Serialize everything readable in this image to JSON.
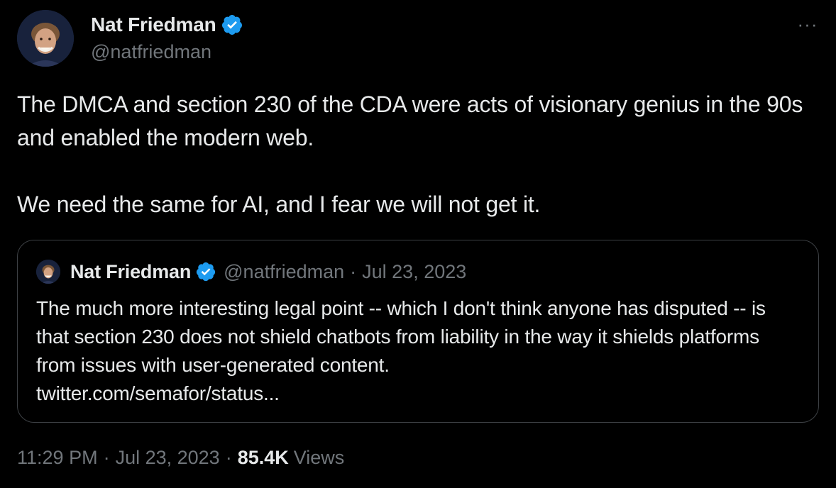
{
  "tweet": {
    "author": {
      "name": "Nat Friedman",
      "handle": "@natfriedman",
      "avatar_icon": "profile-photo"
    },
    "verified_icon": "verified-badge-icon",
    "more_icon": "more-horizontal-icon",
    "more_glyph": "···",
    "text": "The DMCA and section 230 of the CDA were acts of visionary genius in the 90s and enabled the modern web.\n\nWe need the same for AI, and I fear we will not get it.",
    "quote": {
      "name": "Nat Friedman",
      "handle": "@natfriedman",
      "separator": "·",
      "date": "Jul 23, 2023",
      "text": "The much more interesting legal point -- which I don't think anyone has disputed -- is that section 230 does not shield chatbots from liability in the way it shields platforms from issues with user-generated content.",
      "link": "twitter.com/semafor/status..."
    },
    "meta": {
      "time": "11:29 PM",
      "separator": "·",
      "date": "Jul 23, 2023",
      "views_count": "85.4K",
      "views_label": "Views"
    }
  },
  "colors": {
    "background": "#000000",
    "primary_text": "#e7e9ea",
    "secondary_text": "#71767b",
    "verified_blue": "#1d9bf0",
    "border": "#3d4145"
  }
}
